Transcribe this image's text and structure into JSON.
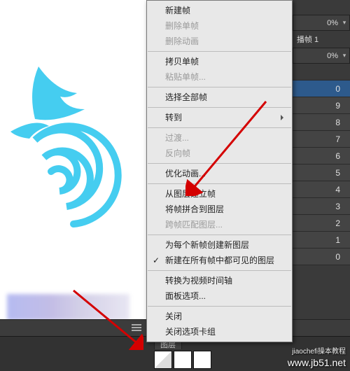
{
  "menu": {
    "items": [
      {
        "label": "新建帧",
        "type": "item"
      },
      {
        "label": "删除单帧",
        "type": "disabled"
      },
      {
        "label": "删除动画",
        "type": "disabled"
      },
      {
        "type": "sep"
      },
      {
        "label": "拷贝单帧",
        "type": "item"
      },
      {
        "label": "粘贴单帧...",
        "type": "disabled"
      },
      {
        "type": "sep"
      },
      {
        "label": "选择全部帧",
        "type": "item"
      },
      {
        "type": "sep"
      },
      {
        "label": "转到",
        "type": "sub"
      },
      {
        "type": "sep"
      },
      {
        "label": "过渡...",
        "type": "disabled"
      },
      {
        "label": "反向帧",
        "type": "disabled"
      },
      {
        "type": "sep"
      },
      {
        "label": "优化动画...",
        "type": "item"
      },
      {
        "type": "sep"
      },
      {
        "label": "从图层建立帧",
        "type": "item"
      },
      {
        "label": "将帧拼合到图层",
        "type": "item"
      },
      {
        "label": "跨帧匹配图层...",
        "type": "disabled"
      },
      {
        "type": "sep"
      },
      {
        "label": "为每个新帧创建新图层",
        "type": "item"
      },
      {
        "label": "新建在所有帧中都可见的图层",
        "type": "checked"
      },
      {
        "type": "sep"
      },
      {
        "label": "转换为视频时间轴",
        "type": "item"
      },
      {
        "label": "面板选项...",
        "type": "item"
      },
      {
        "type": "sep"
      },
      {
        "label": "关闭",
        "type": "item"
      },
      {
        "label": "关闭选项卡组",
        "type": "item"
      }
    ]
  },
  "rail": {
    "row1_pct": "0%",
    "row2_pct": "0%",
    "mid_label": "播帧 1",
    "layers": [
      "",
      "0",
      "9",
      "8",
      "7",
      "6",
      "5",
      "4",
      "3",
      "2",
      "1",
      "0"
    ]
  },
  "bottom": {
    "tab_layers": "图层",
    "tab_channels": ""
  },
  "watermark": {
    "line1": "www.jb51.net",
    "line2": "jiaochefi操本教程"
  }
}
